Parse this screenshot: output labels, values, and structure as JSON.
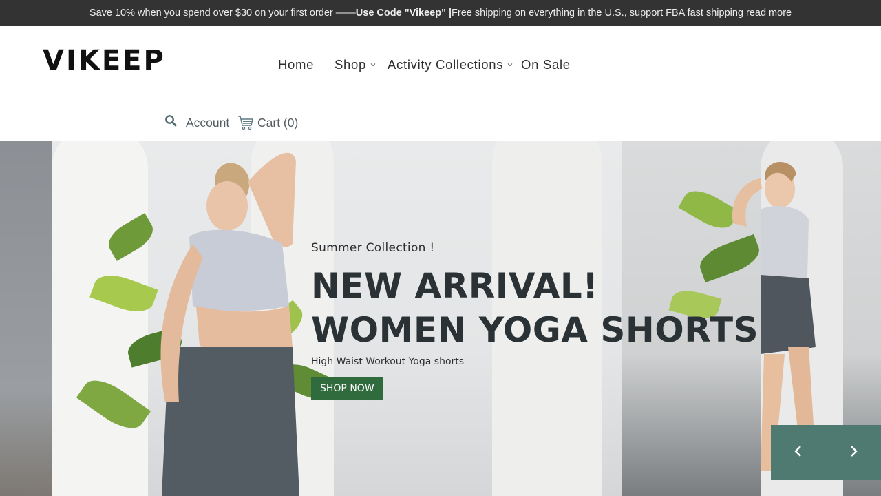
{
  "announcement": {
    "text_before": "Save 10% when you spend over $30 on your first order ——",
    "code_text": "Use Code \"Vikeep\" |",
    "text_after": " Free shipping on everything in the U.S., support FBA fast shipping ",
    "link_label": "read more"
  },
  "header": {
    "logo": "VIKEEP",
    "nav": [
      {
        "label": "Home",
        "dropdown": false
      },
      {
        "label": "Shop",
        "dropdown": true
      },
      {
        "label": "Activity Collections",
        "dropdown": true
      },
      {
        "label": "On Sale",
        "dropdown": false
      }
    ],
    "search_icon": "search-icon",
    "account_label": "Account",
    "cart_icon": "cart-icon",
    "cart_label": "Cart (0)"
  },
  "hero": {
    "subhead": "Summer Collection !",
    "headline_line1": "NEW ARRIVAL!",
    "headline_line2": "WOMEN YOGA SHORTS",
    "tagline": "High Waist Workout Yoga shorts",
    "button_label": "SHOP NOW",
    "prev_icon": "chevron-left-icon",
    "next_icon": "chevron-right-icon"
  },
  "colors": {
    "announcement_bg": "#333333",
    "button_bg": "#2f6b3c",
    "slider_nav_bg": "#4f7a72"
  }
}
